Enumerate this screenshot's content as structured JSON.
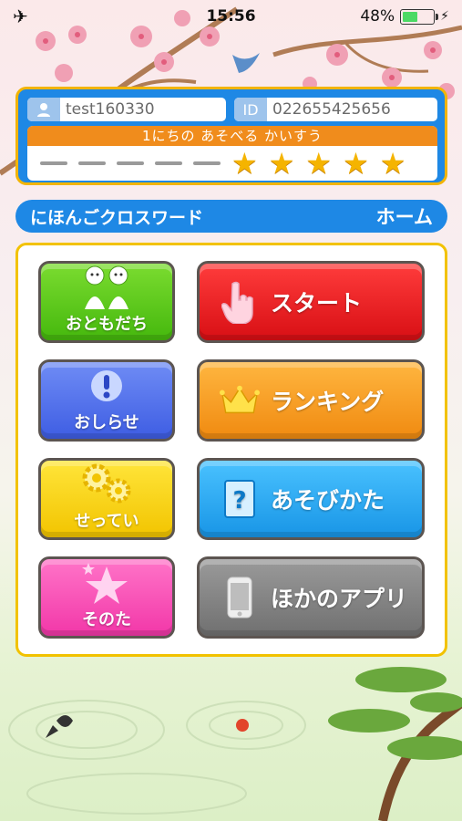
{
  "status_bar": {
    "time": "15:56",
    "battery": "48%",
    "battery_level": 0.48
  },
  "user": {
    "name": "test160330",
    "id_label": "ID",
    "id_value": "022655425656"
  },
  "daily_plays": {
    "title": "1にちの あそべる かいすう",
    "remaining_stars": 5,
    "used_dashes": 5
  },
  "header": {
    "app_title": "にほんごクロスワード",
    "page": "ホーム"
  },
  "menu": {
    "friends": "おともだち",
    "news": "おしらせ",
    "settings": "せってい",
    "other": "そのた",
    "start": "スタート",
    "ranking": "ランキング",
    "howto": "あそびかた",
    "other_apps": "ほかのアプリ"
  },
  "colors": {
    "primary_blue": "#1e88e5",
    "accent_orange": "#f08c1c",
    "star_gold": "#f5b400",
    "frame_gold": "#f2c200"
  }
}
